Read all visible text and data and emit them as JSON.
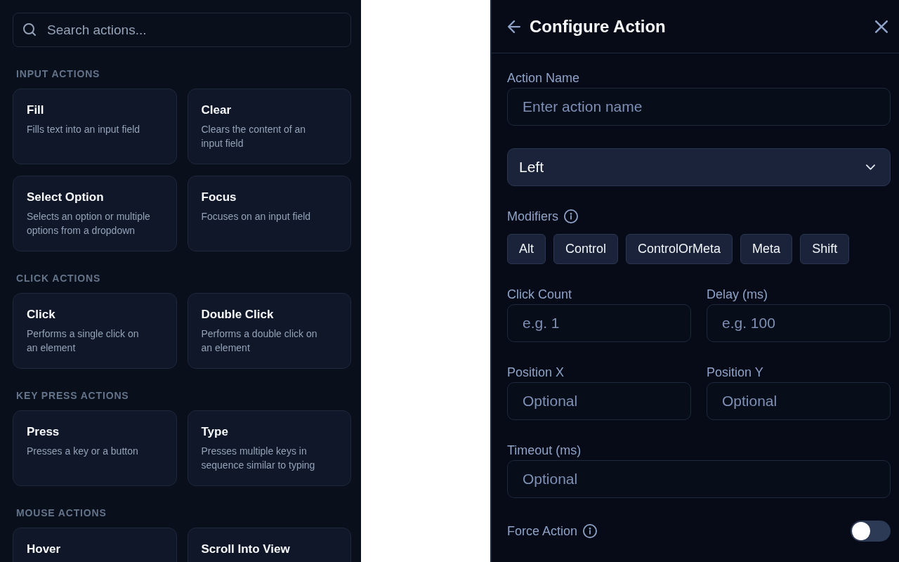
{
  "search": {
    "placeholder": "Search actions..."
  },
  "sections": [
    {
      "heading": "INPUT ACTIONS",
      "actions": [
        {
          "title": "Fill",
          "description": "Fills text into an input field"
        },
        {
          "title": "Clear",
          "description": "Clears the content of an input field"
        },
        {
          "title": "Select Option",
          "description": "Selects an option or multiple options from a dropdown"
        },
        {
          "title": "Focus",
          "description": "Focuses on an input field"
        }
      ]
    },
    {
      "heading": "CLICK ACTIONS",
      "actions": [
        {
          "title": "Click",
          "description": "Performs a single click on an element"
        },
        {
          "title": "Double Click",
          "description": "Performs a double click on an element"
        }
      ]
    },
    {
      "heading": "KEY PRESS ACTIONS",
      "actions": [
        {
          "title": "Press",
          "description": "Presses a key or a button"
        },
        {
          "title": "Type",
          "description": "Presses multiple keys in sequence similar to typing"
        }
      ]
    },
    {
      "heading": "MOUSE ACTIONS",
      "actions": [
        {
          "title": "Hover"
        },
        {
          "title": "Scroll Into View"
        }
      ]
    }
  ],
  "panel": {
    "title": "Configure Action",
    "fields": [
      {
        "kind": "text",
        "label": "Action Name",
        "placeholder": "Enter action name"
      },
      {
        "kind": "select",
        "value": "Left"
      },
      {
        "kind": "chips",
        "label": "Modifiers",
        "info": true,
        "options": [
          "Alt",
          "Control",
          "ControlOrMeta",
          "Meta",
          "Shift"
        ]
      },
      {
        "kind": "pair",
        "items": [
          {
            "label": "Click Count",
            "placeholder": "e.g. 1"
          },
          {
            "label": "Delay (ms)",
            "placeholder": "e.g. 100"
          }
        ]
      },
      {
        "kind": "pair",
        "items": [
          {
            "label": "Position X",
            "placeholder": "Optional"
          },
          {
            "label": "Position Y",
            "placeholder": "Optional"
          }
        ]
      },
      {
        "kind": "text",
        "label": "Timeout (ms)",
        "placeholder": "Optional"
      },
      {
        "kind": "toggle",
        "label": "Force Action",
        "info": true,
        "on": false
      }
    ]
  }
}
